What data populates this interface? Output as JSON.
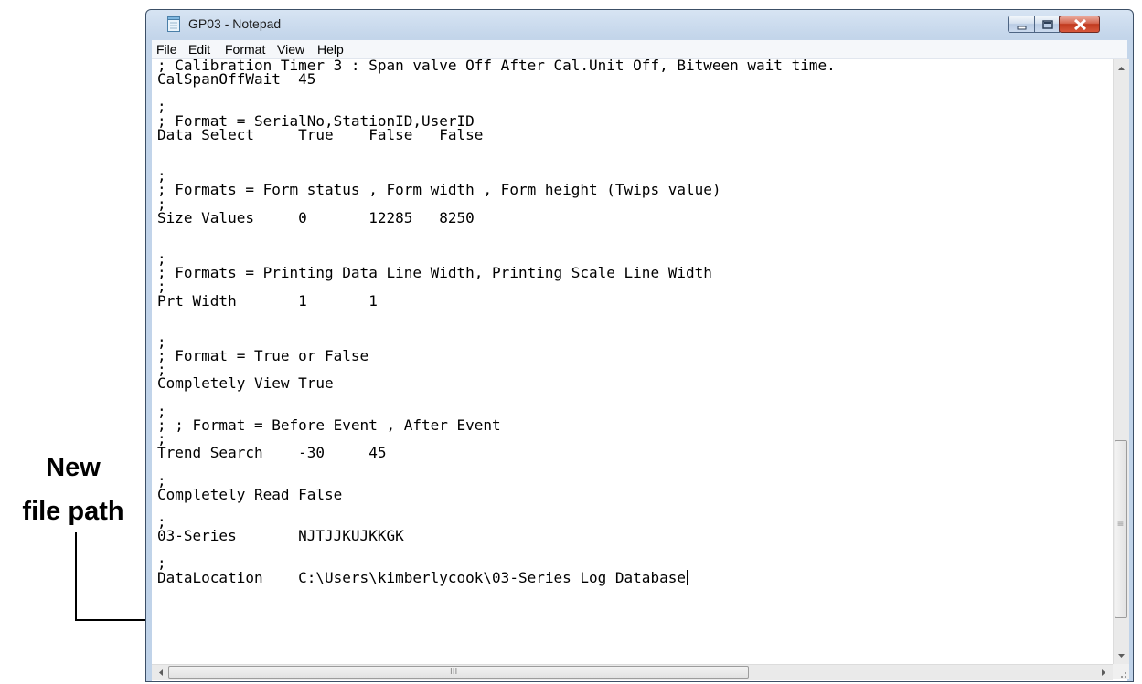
{
  "annotation": {
    "line1": "New",
    "line2": "file path"
  },
  "window": {
    "title": "GP03 - Notepad"
  },
  "menu": [
    "File",
    "Edit",
    "Format",
    "View",
    "Help"
  ],
  "content_lines": [
    "; Calibration Timer 3 : Span valve Off After Cal.Unit Off, Bitween wait time.",
    "CalSpanOffWait  45",
    "",
    ";",
    "; Format = SerialNo,StationID,UserID",
    "Data Select     True    False   False",
    "",
    "",
    ";",
    "; Formats = Form status , Form width , Form height (Twips value)",
    ";",
    "Size Values     0       12285   8250",
    "",
    "",
    ";",
    "; Formats = Printing Data Line Width, Printing Scale Line Width",
    ";",
    "Prt Width       1       1",
    "",
    "",
    ";",
    "; Format = True or False",
    ";",
    "Completely View True",
    "",
    ";",
    "; ; Format = Before Event , After Event",
    ";",
    "Trend Search    -30     45",
    "",
    ";",
    "Completely Read False",
    "",
    ";",
    "03-Series       NJTJJKUJKKGK",
    "",
    ";",
    "DataLocation    C:\\Users\\kimberlycook\\03-Series Log Database"
  ],
  "scrollbars": {
    "hthumb_grip": "III",
    "vthumb_grip": "≡"
  }
}
